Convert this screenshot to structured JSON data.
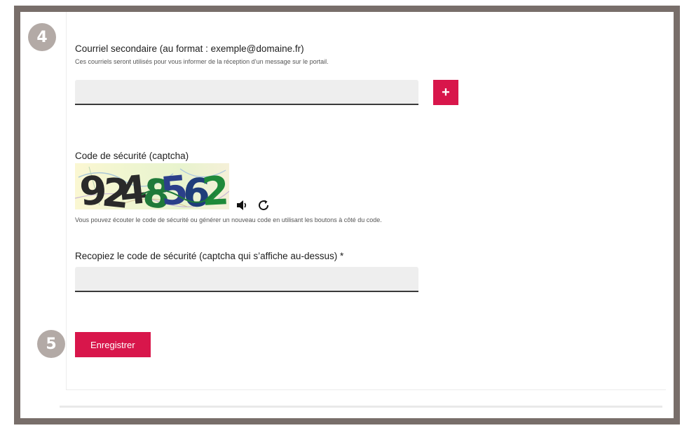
{
  "steps": {
    "step4": "4",
    "step5": "5"
  },
  "secondary_email": {
    "label": "Courriel secondaire (au format : exemple@domaine.fr)",
    "hint": "Ces courriels seront utilisés pour vous informer de la réception d’un message sur le portail.",
    "value": "",
    "placeholder": "",
    "add_button_label": "+"
  },
  "captcha": {
    "label": "Code de sécurité (captcha)",
    "code_text": "9248562",
    "audio_icon": "speaker-icon",
    "refresh_icon": "refresh-icon",
    "hint": "Vous pouvez écouter le code de sécurité ou générer un nouveau code en utilisant les boutons à côté du code.",
    "input_label": "Recopiez le code de sécurité (captcha qui s’affiche au-dessus) *",
    "input_value": ""
  },
  "actions": {
    "submit_label": "Enregistrer"
  },
  "colors": {
    "accent": "#d8164b",
    "badge": "#b3aaa6",
    "frame": "#786e6a",
    "field_background": "#eeeeee"
  }
}
